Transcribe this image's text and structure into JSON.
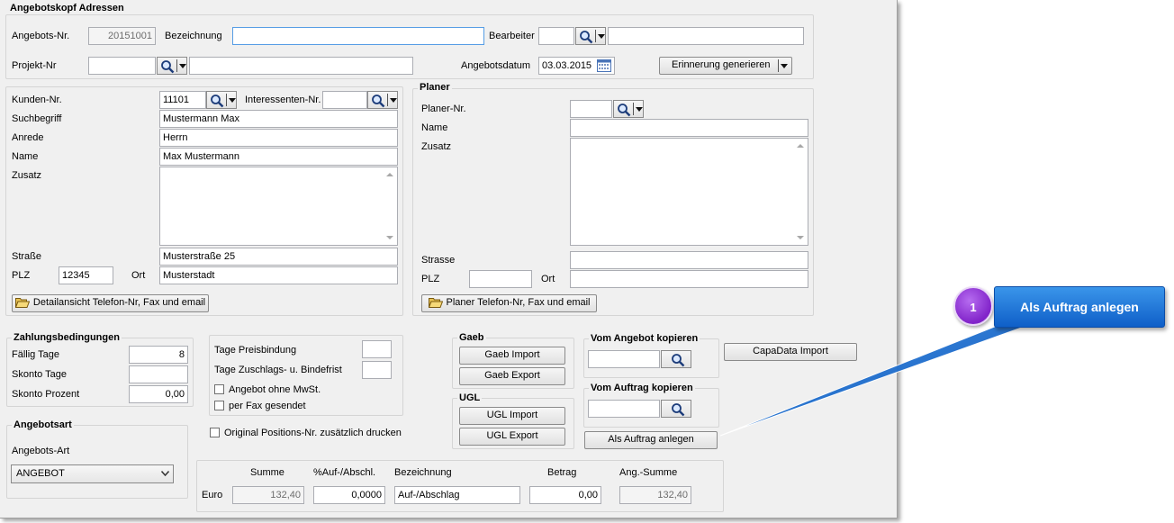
{
  "header_group": {
    "title": "Angebotskopf Adressen",
    "angebots_nr_label": "Angebots-Nr.",
    "angebots_nr_value": "20151001",
    "bezeichnung_label": "Bezeichnung",
    "bezeichnung_value": "",
    "bearbeiter_label": "Bearbeiter",
    "bearbeiter_value": "",
    "bearbeiter_name_value": "",
    "projekt_nr_label": "Projekt-Nr",
    "projekt_nr_value": "",
    "projekt_name_value": "",
    "angebotsdatum_label": "Angebotsdatum",
    "angebotsdatum_value": "03.03.2015",
    "erinnerung_button": "Erinnerung generieren"
  },
  "customer": {
    "kunden_nr_label": "Kunden-Nr.",
    "kunden_nr_value": "11101",
    "interessenten_nr_label": "Interessenten-Nr.",
    "interessenten_nr_value": "",
    "suchbegriff_label": "Suchbegriff",
    "suchbegriff_value": "Mustermann Max",
    "anrede_label": "Anrede",
    "anrede_value": "Herrn",
    "name_label": "Name",
    "name_value": "Max Mustermann",
    "zusatz_label": "Zusatz",
    "zusatz_value": "",
    "strasse_label": "Straße",
    "strasse_value": "Musterstraße 25",
    "plz_label": "PLZ",
    "plz_value": "12345",
    "ort_label": "Ort",
    "ort_value": "Musterstadt",
    "detail_button": "Detailansicht Telefon-Nr, Fax und email"
  },
  "planer": {
    "title": "Planer",
    "planer_nr_label": "Planer-Nr.",
    "planer_nr_value": "",
    "name_label": "Name",
    "name_value": "",
    "zusatz_label": "Zusatz",
    "zusatz_value": "",
    "strasse_label": "Strasse",
    "strasse_value": "",
    "plz_label": "PLZ",
    "plz_value": "",
    "ort_label": "Ort",
    "ort_value": "",
    "telefon_button": "Planer Telefon-Nr, Fax und email"
  },
  "zahlung": {
    "title": "Zahlungsbedingungen",
    "faellig_label": "Fällig Tage",
    "faellig_value": "8",
    "skonto_tage_label": "Skonto Tage",
    "skonto_tage_value": "",
    "skonto_prozent_label": "Skonto Prozent",
    "skonto_prozent_value": "0,00"
  },
  "options": {
    "preisbindung_label": "Tage Preisbindung",
    "preisbindung_value": "",
    "zuschlag_label": "Tage Zuschlags- u. Bindefrist",
    "zuschlag_value": "",
    "ohne_mwst_label": "Angebot ohne MwSt.",
    "fax_label": "per Fax gesendet",
    "original_pos_label": "Original Positions-Nr.  zusätzlich drucken"
  },
  "angebotsart": {
    "title": "Angebotsart",
    "label": "Angebots-Art",
    "selected": "ANGEBOT"
  },
  "gaeb": {
    "title": "Gaeb",
    "import_button": "Gaeb Import",
    "export_button": "Gaeb Export"
  },
  "ugl": {
    "title": "UGL",
    "import_button": "UGL Import",
    "export_button": "UGL Export"
  },
  "copy": {
    "vom_angebot_title": "Vom Angebot kopieren",
    "vom_angebot_value": "",
    "vom_auftrag_title": "Vom Auftrag kopieren",
    "vom_auftrag_value": "",
    "als_auftrag_button": "Als Auftrag anlegen",
    "capadata_button": "CapaData Import"
  },
  "summary": {
    "col_summe": "Summe",
    "col_auf_abschl": "%Auf-/Abschl.",
    "col_bezeichnung": "Bezeichnung",
    "col_betrag": "Betrag",
    "col_ang_summe": "Ang.-Summe",
    "currency": "Euro",
    "summe_value": "132,40",
    "auf_abschl_value": "0,0000",
    "bezeichnung_value": "Auf-/Abschlag",
    "betrag_value": "0,00",
    "ang_summe_value": "132,40"
  },
  "callout": {
    "number": "1",
    "text": "Als Auftrag anlegen"
  },
  "colors": {
    "window_bg": "#f0f0f0",
    "callout_blue": "#1a6fd8",
    "callout_purple": "#8123c9"
  }
}
